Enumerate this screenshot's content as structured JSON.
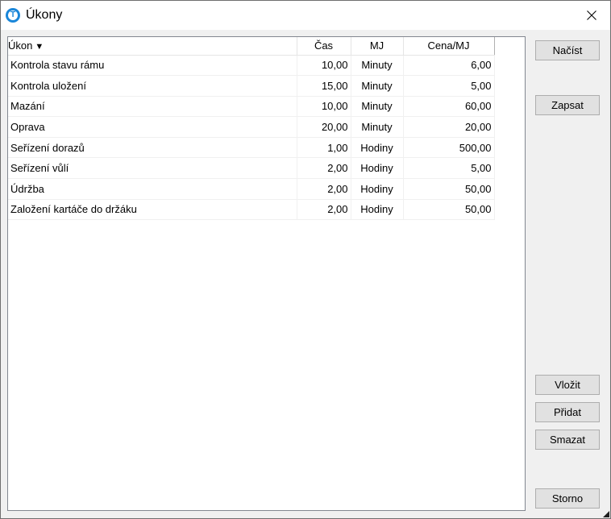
{
  "window": {
    "title": "Úkony"
  },
  "table": {
    "columns": [
      "Úkon",
      "Čas",
      "MJ",
      "Cena/MJ"
    ],
    "sort_indicator": "▼",
    "rows": [
      [
        "Kontrola stavu rámu",
        "10,00",
        "Minuty",
        "6,00"
      ],
      [
        "Kontrola uložení",
        "15,00",
        "Minuty",
        "5,00"
      ],
      [
        "Mazání",
        "10,00",
        "Minuty",
        "60,00"
      ],
      [
        "Oprava",
        "20,00",
        "Minuty",
        "20,00"
      ],
      [
        "Seřízení dorazů",
        "1,00",
        "Hodiny",
        "500,00"
      ],
      [
        "Seřízení vůlí",
        "2,00",
        "Hodiny",
        "5,00"
      ],
      [
        "Údržba",
        "2,00",
        "Hodiny",
        "50,00"
      ],
      [
        "Založení kartáče do držáku",
        "2,00",
        "Hodiny",
        "50,00"
      ]
    ]
  },
  "buttons": {
    "nacist": "Načíst",
    "zapsat": "Zapsat",
    "vlozit": "Vložit",
    "pridat": "Přidat",
    "smazat": "Smazat",
    "storno": "Storno"
  },
  "icons": {
    "app": "app-logo-icon",
    "close": "close-icon"
  },
  "colors": {
    "app_icon": "#1a86d9",
    "dialog_bg": "#f0f0f0",
    "button_bg": "#e1e1e1"
  }
}
